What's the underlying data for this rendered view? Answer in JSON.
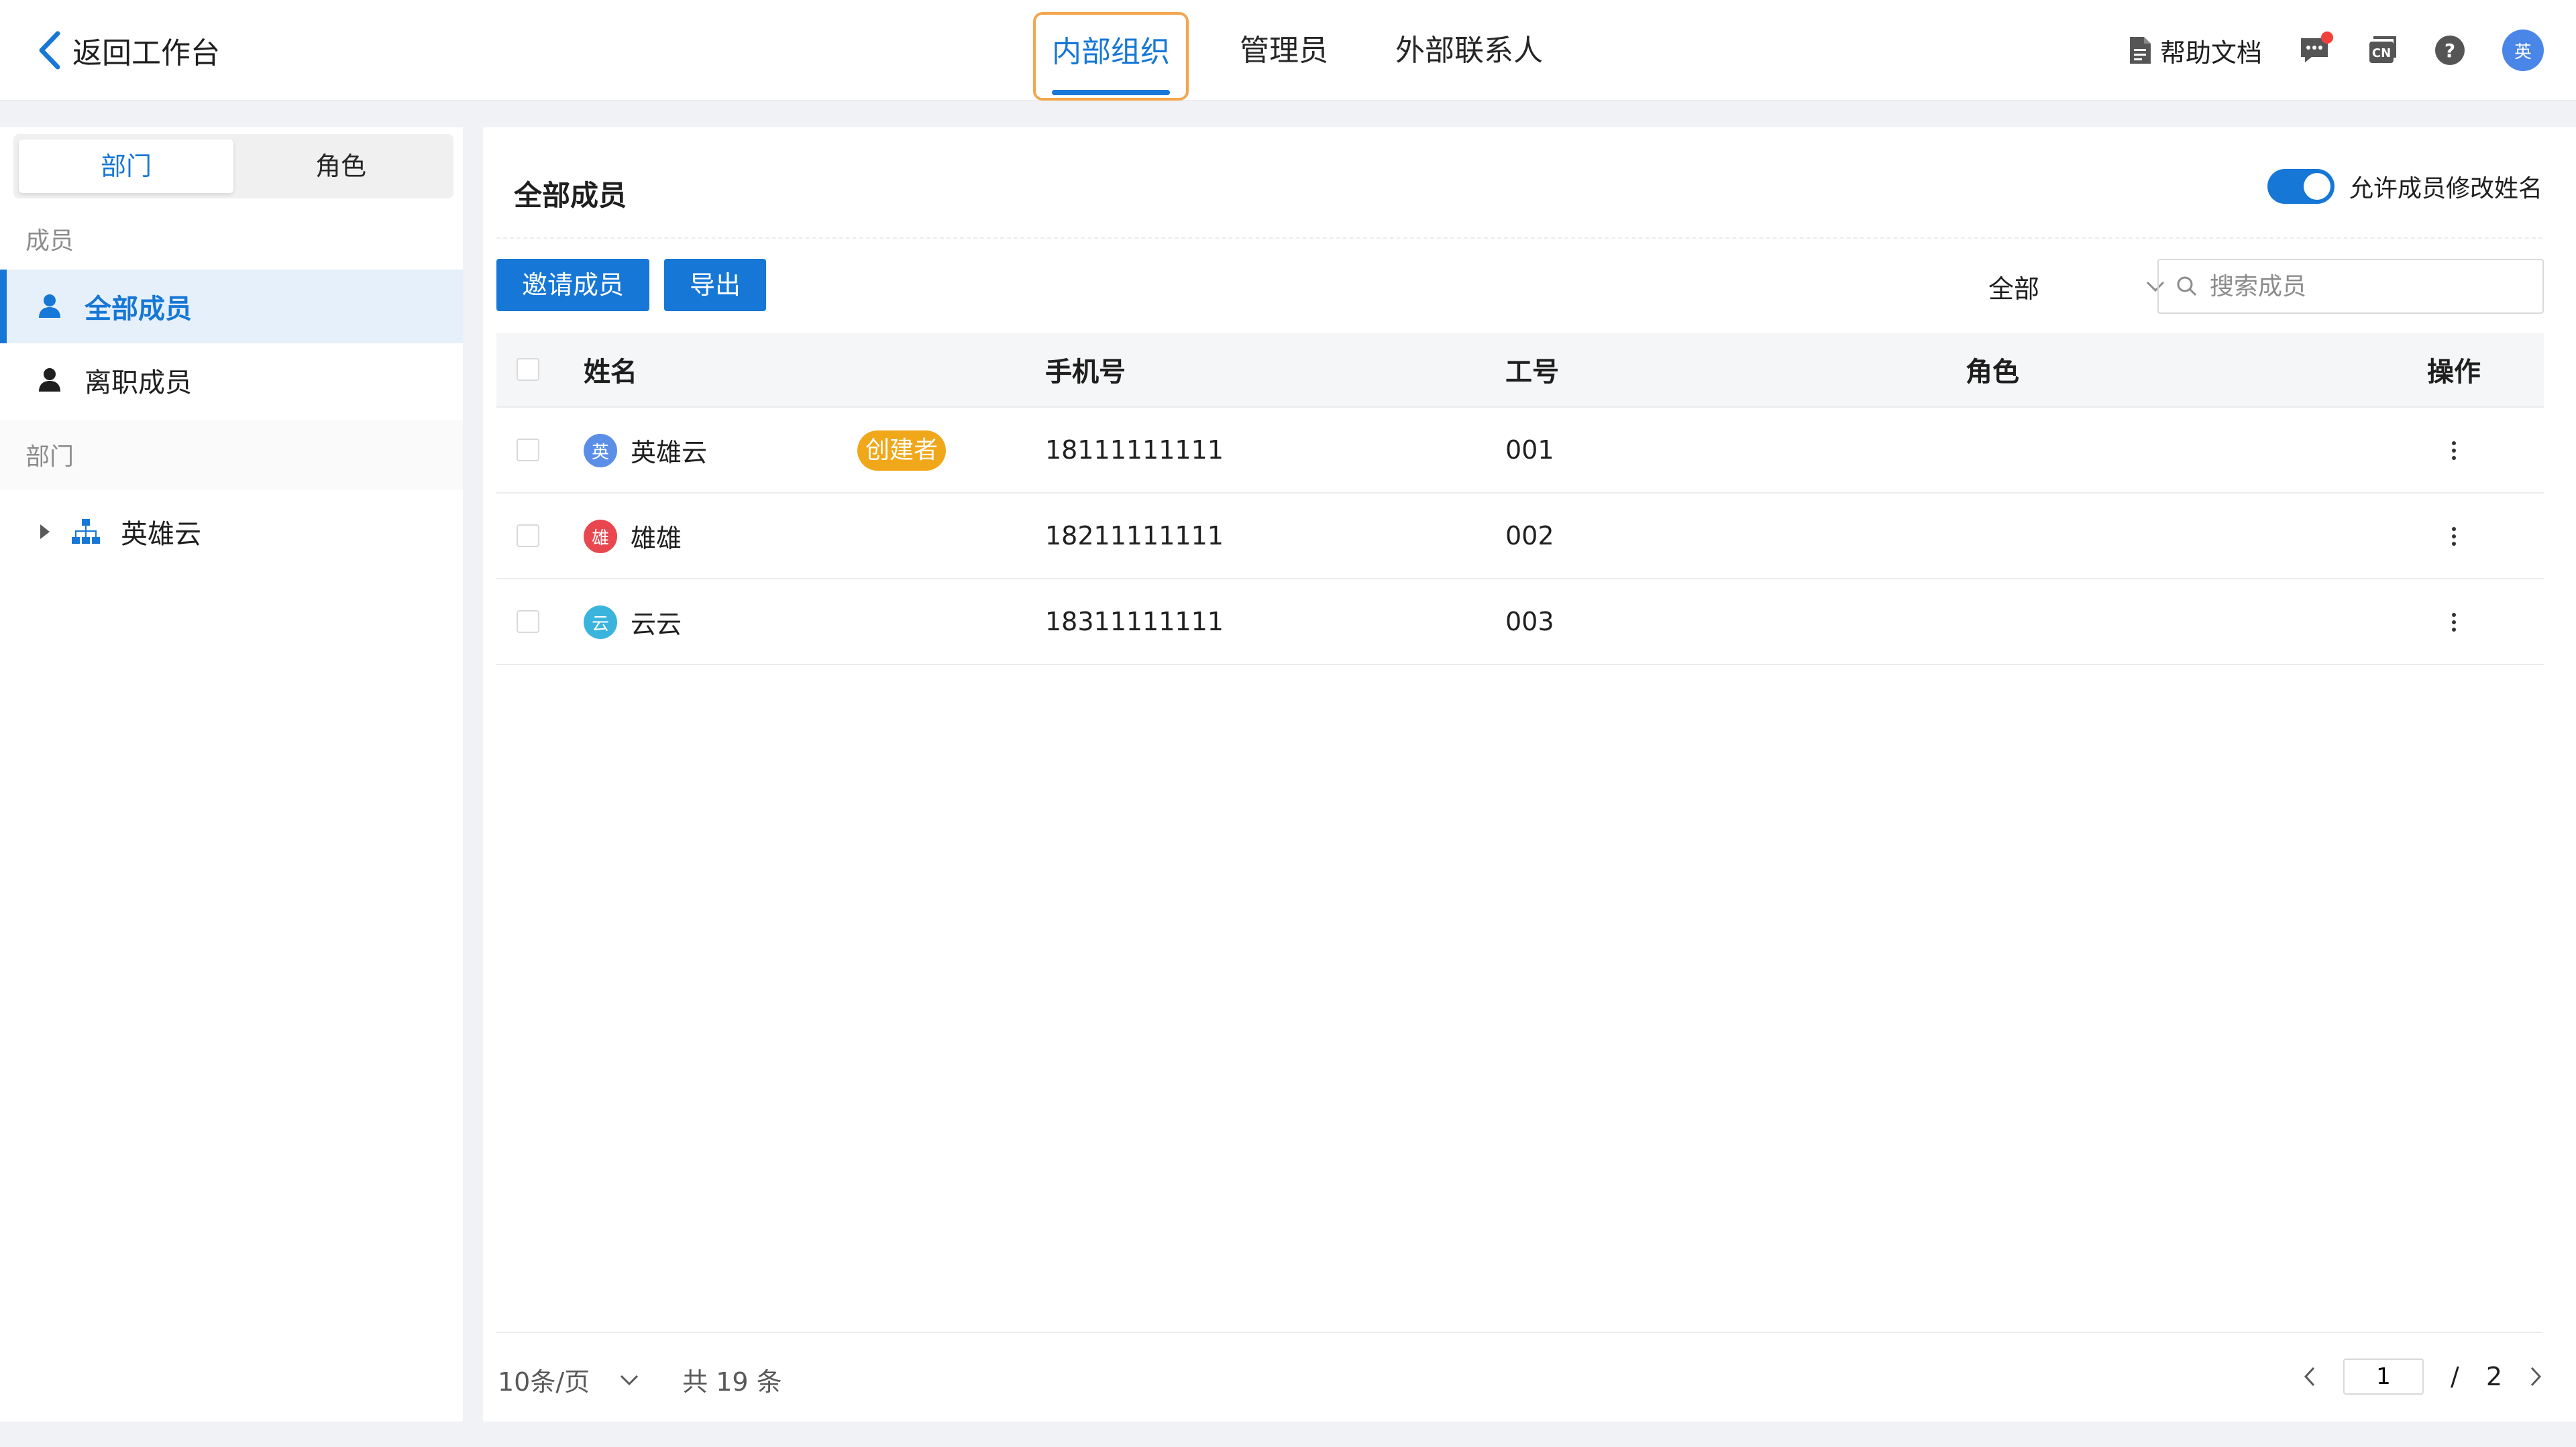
{
  "topbar": {
    "back_label": "返回工作台",
    "tabs": [
      {
        "label": "内部组织",
        "active": true
      },
      {
        "label": "管理员",
        "active": false
      },
      {
        "label": "外部联系人",
        "active": false
      }
    ],
    "help_label": "帮助文档",
    "lang_label": "CN",
    "help_glyph": "?",
    "avatar_text": "英"
  },
  "sidebar": {
    "segments": [
      "部门",
      "角色"
    ],
    "section_members": "成员",
    "items": [
      {
        "label": "全部成员",
        "active": true
      },
      {
        "label": "离职成员",
        "active": false
      }
    ],
    "section_departments": "部门",
    "department_tree": [
      {
        "label": "英雄云"
      }
    ]
  },
  "main": {
    "title": "全部成员",
    "toggle_label": "允许成员修改姓名",
    "toggle_on": true,
    "invite_button": "邀请成员",
    "export_button": "导出",
    "filter_value": "全部",
    "search_placeholder": "搜索成员",
    "columns": [
      "姓名",
      "手机号",
      "工号",
      "角色",
      "操作"
    ],
    "rows": [
      {
        "avatar": "英",
        "avatar_color": "#5b8ee6",
        "name": "英雄云",
        "badge": "创建者",
        "phone": "18111111111",
        "employee_id": "001",
        "role": ""
      },
      {
        "avatar": "雄",
        "avatar_color": "#e8474f",
        "name": "雄雄",
        "badge": "",
        "phone": "18211111111",
        "employee_id": "002",
        "role": ""
      },
      {
        "avatar": "云",
        "avatar_color": "#3ab4dc",
        "name": "云云",
        "badge": "",
        "phone": "18311111111",
        "employee_id": "003",
        "role": ""
      }
    ],
    "pagination": {
      "page_size_label": "10条/页",
      "total_label": "共 19 条",
      "current_page": "1",
      "separator": "/",
      "total_pages": "2"
    }
  },
  "colors": {
    "accent": "#1677d6",
    "badge": "#f0a81a",
    "notification_dot": "#f0413d"
  }
}
